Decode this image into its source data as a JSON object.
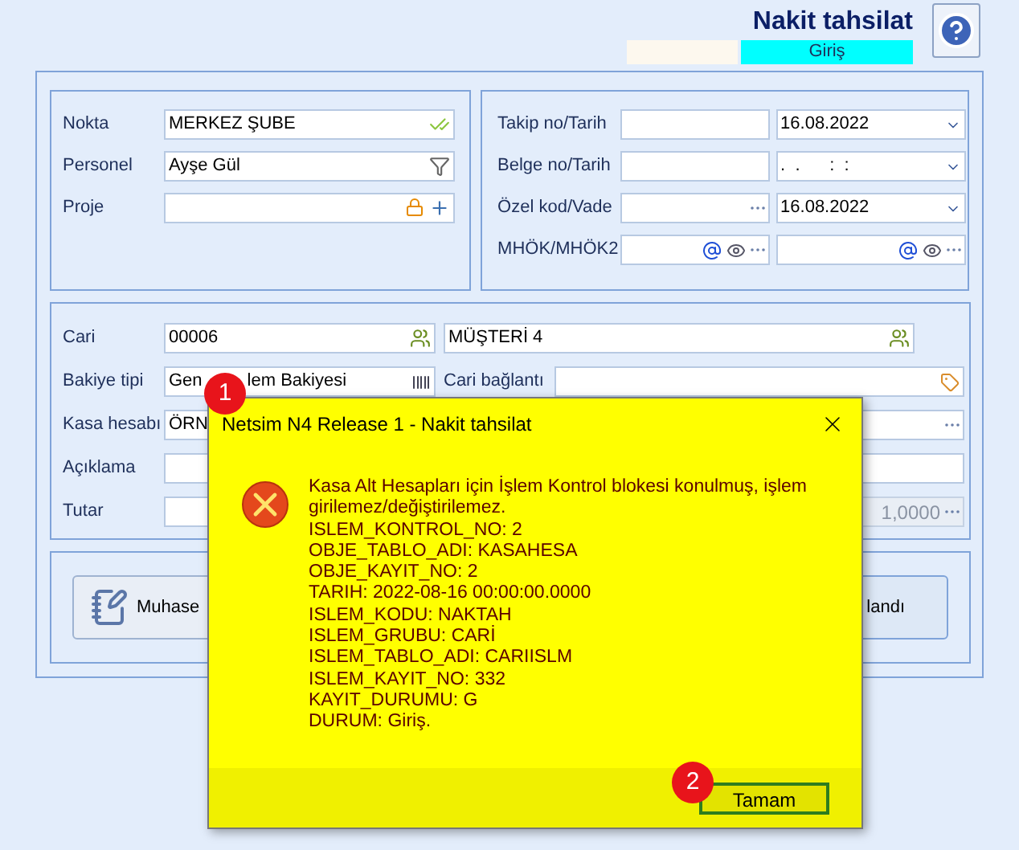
{
  "header": {
    "title": "Nakit tahsilat",
    "status": "Giriş"
  },
  "left_fields": [
    {
      "label": "Nokta",
      "value": "MERKEZ ŞUBE"
    },
    {
      "label": "Personel",
      "value": "Ayşe Gül"
    },
    {
      "label": "Proje"
    }
  ],
  "right_fields": [
    {
      "label": "Takip no/Tarih",
      "second": "16.08.2022",
      "kind": "date"
    },
    {
      "label": "Belge no/Tarih",
      "second": ".  .      :  :",
      "kind": "date"
    },
    {
      "label": "Özel kod/Vade",
      "second": "16.08.2022",
      "kind": "code"
    },
    {
      "label": "MHÖK/MHÖK2",
      "kind": "mhok"
    }
  ],
  "cari": {
    "label": "Cari",
    "code": "00006",
    "name": "MÜŞTERİ 4"
  },
  "bakiye": {
    "label": "Bakiye tipi",
    "value_start": "Gen",
    "value_end": "lem Bakiyesi",
    "link_label": "Cari bağlantı"
  },
  "kasa": {
    "label": "Kasa hesabı",
    "value": "ÖRN"
  },
  "aciklama": {
    "label": "Açıklama"
  },
  "tutar": {
    "label": "Tutar",
    "rate": "1,0000"
  },
  "buttons": [
    "Muhase",
    "landı"
  ],
  "dialog": {
    "title": "Netsim N4 Release 1 - Nakit tahsilat",
    "message": "Kasa Alt Hesapları için İşlem Kontrol blokesi konulmuş, işlem girilemez/değiştirilemez.",
    "details": [
      "ISLEM_KONTROL_NO: 2",
      "OBJE_TABLO_ADI: KASAHESA",
      "OBJE_KAYIT_NO: 2",
      "TARIH: 2022-08-16 00:00:00.0000",
      "ISLEM_KODU: NAKTAH",
      "ISLEM_GRUBU: CARİ",
      "ISLEM_TABLO_ADI: CARIISLM",
      "ISLEM_KAYIT_NO: 332",
      "KAYIT_DURUMU: G",
      "DURUM: Giriş."
    ],
    "ok": "Tamam"
  },
  "markers": [
    "1",
    "2"
  ]
}
